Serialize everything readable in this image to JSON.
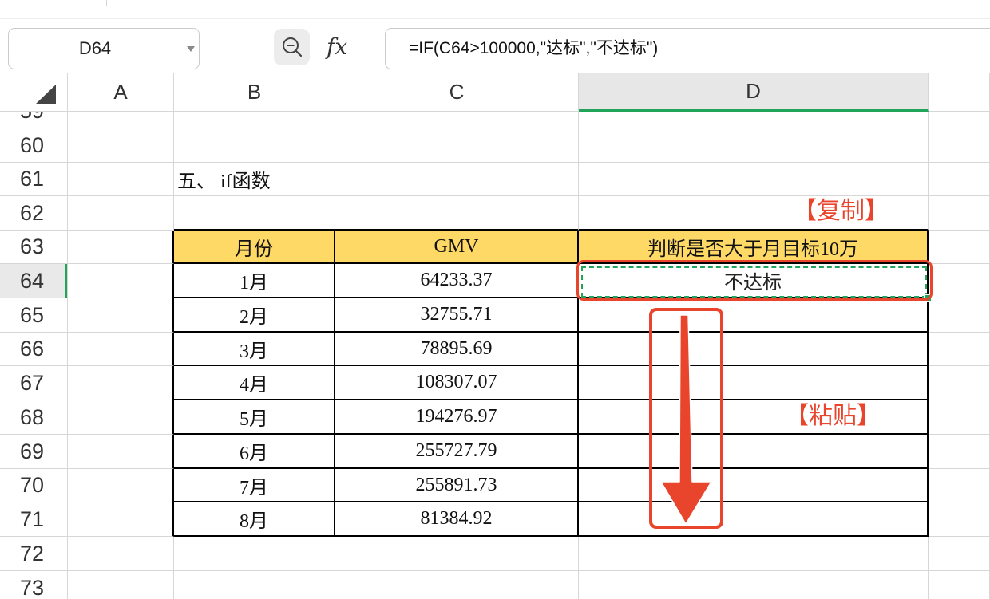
{
  "toolbar": {
    "name_box": "D64",
    "name_box_dropdown_icon": "chevron-down-icon",
    "zoom_icon": "zoom-out-icon",
    "fx_label": "fx",
    "formula": "=IF(C64>100000,\"达标\",\"不达标\")"
  },
  "sheet": {
    "corner_icon": "select-all-triangle-icon",
    "column_headers": [
      "A",
      "B",
      "C",
      "D"
    ],
    "row_numbers": [
      "59",
      "60",
      "61",
      "62",
      "63",
      "64",
      "65",
      "66",
      "67",
      "68",
      "69",
      "70",
      "71",
      "72",
      "73"
    ],
    "section_title": "五、 if函数"
  },
  "table": {
    "headers": [
      "月份",
      "GMV",
      "判断是否大于月目标10万"
    ],
    "rows": [
      {
        "month": "1月",
        "gmv": "64233.37",
        "result": "不达标"
      },
      {
        "month": "2月",
        "gmv": "32755.71"
      },
      {
        "month": "3月",
        "gmv": "78895.69"
      },
      {
        "month": "4月",
        "gmv": "108307.07"
      },
      {
        "month": "5月",
        "gmv": "194276.97"
      },
      {
        "month": "6月",
        "gmv": "255727.79"
      },
      {
        "month": "7月",
        "gmv": "255891.73"
      },
      {
        "month": "8月",
        "gmv": "81384.92"
      }
    ]
  },
  "annotations": {
    "copy_label": "【复制】",
    "paste_label": "【粘贴】",
    "arrow_icon": "down-arrow-icon"
  },
  "colors": {
    "header_fill": "#FFD966",
    "selection_green": "#22A35A",
    "annotation_red": "#E8452C",
    "gridline": "#D6D6D6",
    "table_border": "#000000"
  }
}
